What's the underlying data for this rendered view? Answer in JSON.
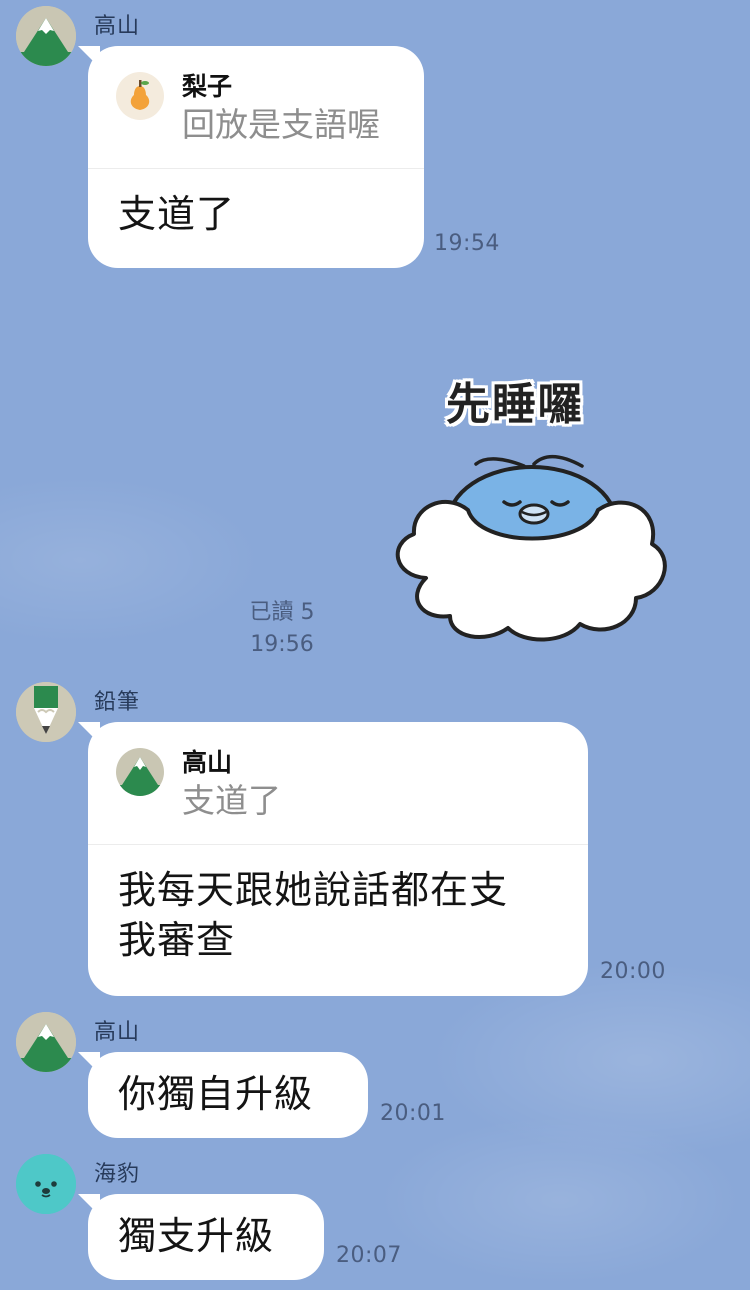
{
  "messages": [
    {
      "sender": "高山",
      "avatar_icon": "mountain-icon",
      "reply": {
        "name": "梨子",
        "avatar_icon": "pear-icon",
        "quote": "回放是支語喔"
      },
      "text": "支道了",
      "time": "19:54"
    },
    {
      "sticker_caption": "先睡囉",
      "sticker_icon": "sleeping-bird-cloud-sticker",
      "read_status": "已讀 5",
      "time": "19:56"
    },
    {
      "sender": "鉛筆",
      "avatar_icon": "pencil-icon",
      "reply": {
        "name": "高山",
        "avatar_icon": "mountain-icon",
        "quote": "支道了"
      },
      "text_line1": "我每天跟她說話都在支",
      "text_line2": "我審查",
      "time": "20:00"
    },
    {
      "sender": "高山",
      "avatar_icon": "mountain-icon",
      "text": "你獨自升級",
      "time": "20:01"
    },
    {
      "sender": "海豹",
      "avatar_icon": "seal-icon",
      "text": "獨支升級",
      "time": "20:07"
    }
  ],
  "colors": {
    "background": "#8aa8d8",
    "bubble": "#ffffff",
    "timestamp": "#4a5d80",
    "mountain_green": "#2c8a4e",
    "seal_teal": "#4ec8c8",
    "pear_orange": "#f3a23a"
  }
}
